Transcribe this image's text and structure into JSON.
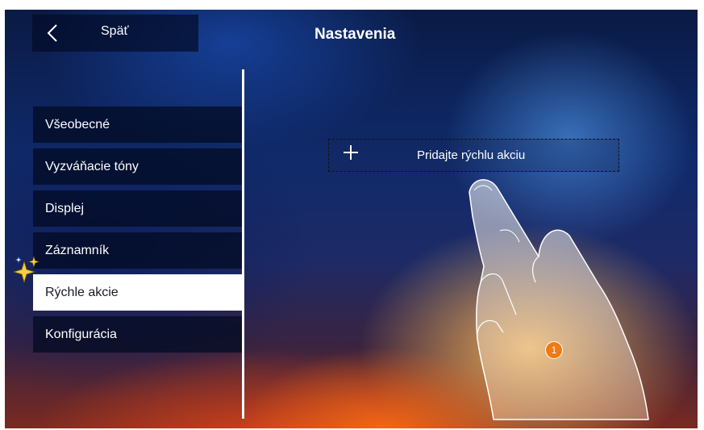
{
  "header": {
    "back_label": "Späť",
    "title": "Nastavenia"
  },
  "menu": {
    "items": [
      {
        "label": "Všeobecné",
        "selected": false
      },
      {
        "label": "Vyzváňacie tóny",
        "selected": false
      },
      {
        "label": "Displej",
        "selected": false
      },
      {
        "label": "Záznamník",
        "selected": false
      },
      {
        "label": "Rýchle akcie",
        "selected": true
      },
      {
        "label": "Konfigurácia",
        "selected": false
      }
    ]
  },
  "main": {
    "add_action_label": "Pridajte rýchlu akciu"
  },
  "callout": {
    "step_number": "1"
  },
  "colors": {
    "accent_badge": "#f07a14",
    "selected_bg": "#ffffff",
    "menu_bg": "#020a20"
  },
  "icons": {
    "back": "chevron-left-icon",
    "add": "plus-icon",
    "highlight": "sparkle-icon",
    "gesture": "pointing-hand"
  }
}
